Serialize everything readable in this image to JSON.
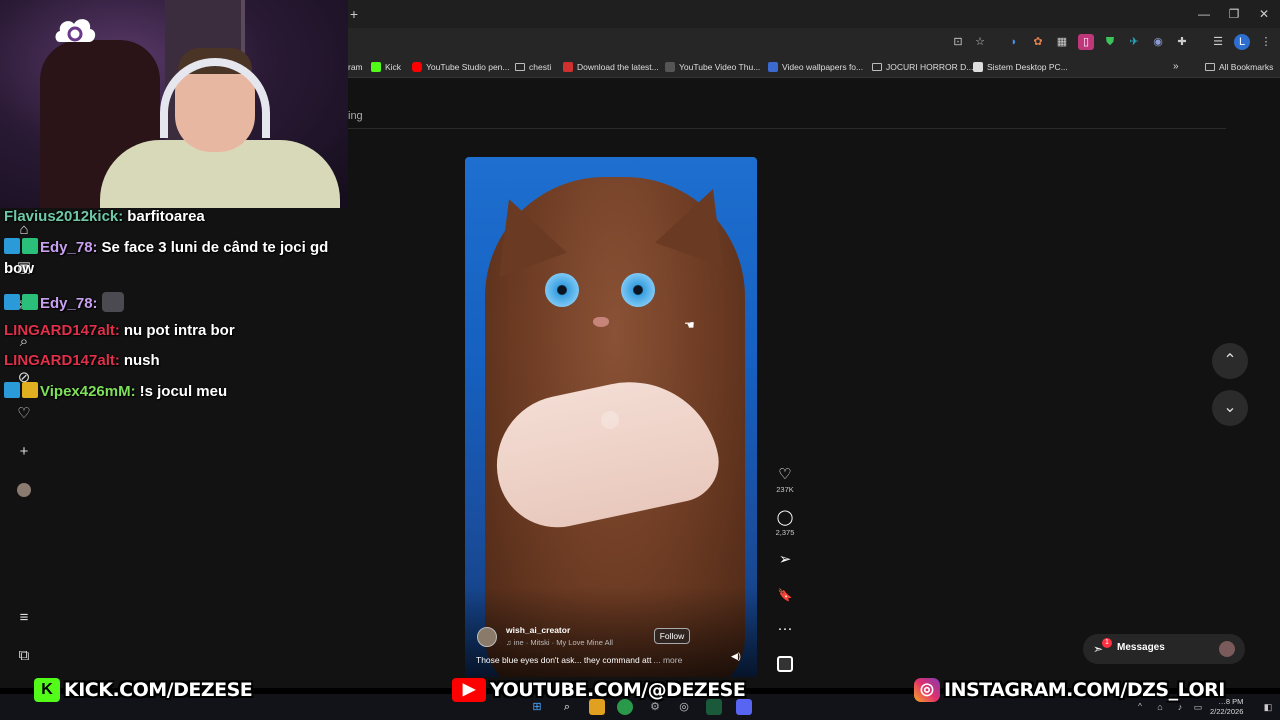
{
  "bookmarks": [
    {
      "label": "ram",
      "icon": "instagram-bookmark-icon"
    },
    {
      "label": "Kick",
      "icon": "kick-icon"
    },
    {
      "label": "YouTube Studio pen...",
      "icon": "youtube-icon"
    },
    {
      "label": "chesti",
      "icon": "folder-icon"
    },
    {
      "label": "Download the latest...",
      "icon": "download-site-icon"
    },
    {
      "label": "YouTube Video Thu...",
      "icon": "site-icon"
    },
    {
      "label": "Video wallpapers fo...",
      "icon": "site-icon"
    },
    {
      "label": "JOCURI HORROR D...",
      "icon": "folder-icon"
    },
    {
      "label": "Sistem Desktop PC...",
      "icon": "site-icon"
    }
  ],
  "all_bookmarks": "All Bookmarks",
  "page_tab_label": "ing",
  "chat": [
    {
      "user": "Flavius2012kick:",
      "text": "barfitoarea",
      "color": "#6ec9a8",
      "badges": []
    },
    {
      "user": "Edy_78:",
      "text": "Se face 3 luni de când te joci gd",
      "color": "#c9a0f0",
      "badges": [
        "kick-badge",
        "sub-badge"
      ]
    },
    {
      "user": "",
      "text": "bow",
      "color": "#ffffff",
      "badges": []
    },
    {
      "user": "Edy_78:",
      "text": "",
      "color": "#c9a0f0",
      "badges": [
        "kick-badge",
        "sub-badge"
      ],
      "emote": true
    },
    {
      "user": "LINGARD147alt:",
      "text": "nu pot intra bor",
      "color": "#e0304a",
      "badges": []
    },
    {
      "user": "LINGARD147alt:",
      "text": "nush",
      "color": "#e0304a",
      "badges": []
    },
    {
      "user": "Vipex426mM:",
      "text": "!s jocul meu",
      "color": "#7ee05a",
      "badges": [
        "kick-badge",
        "crown-badge"
      ]
    }
  ],
  "video": {
    "creator": "wish_ai_creator",
    "music": "♫  ine · Mitski · My Love Mine All",
    "follow_label": "Follow",
    "caption": "Those blue eyes don't ask... they command att",
    "caption_more": "... more"
  },
  "actions": [
    {
      "name": "like",
      "icon": "♡",
      "count": "237K"
    },
    {
      "name": "comment",
      "icon": "◯",
      "count": "2,375"
    },
    {
      "name": "share",
      "icon": "➢",
      "count": ""
    },
    {
      "name": "save",
      "icon": "🔖",
      "count": ""
    },
    {
      "name": "more",
      "icon": "···",
      "count": ""
    }
  ],
  "messages_label": "Messages",
  "messages_badge": "1",
  "banner": {
    "kick": "KICK.COM/DEZESE",
    "youtube": "YOUTUBE.COM/@DEZESE",
    "instagram": "INSTAGRAM.COM/DZS_LORI"
  },
  "clock": {
    "time": "…8 PM",
    "date": "2/22/2026"
  },
  "colors": {
    "kick_green": "#53fc18",
    "youtube_red": "#ff0000",
    "ig_purple": "#c13584",
    "accent_blue": "#1e6fd0"
  }
}
